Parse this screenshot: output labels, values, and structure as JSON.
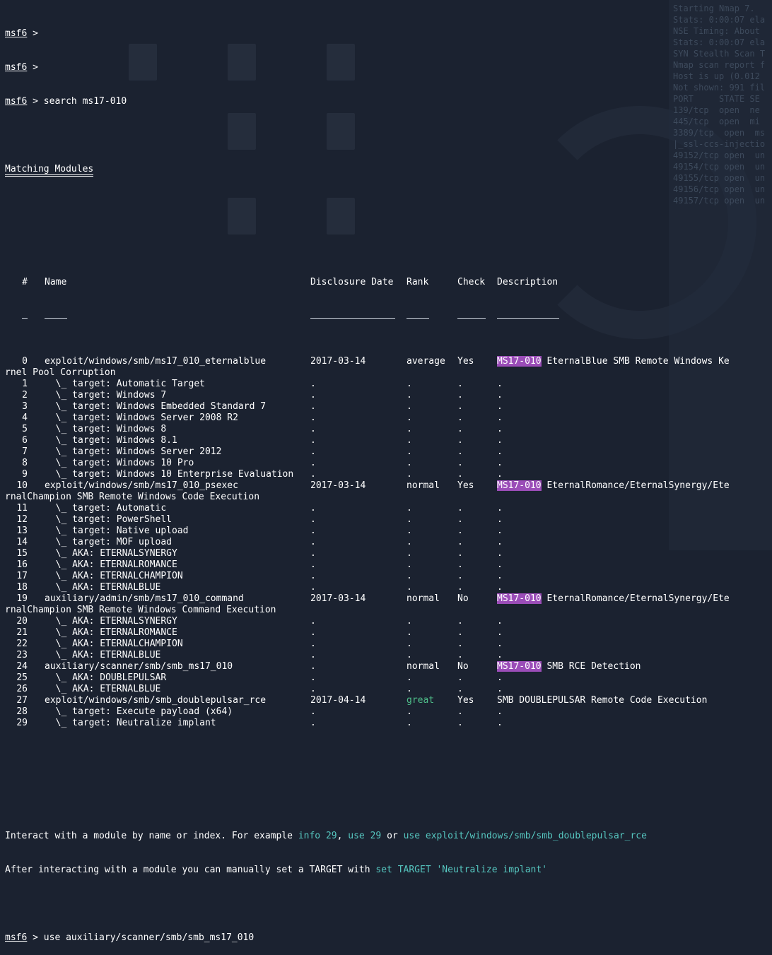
{
  "background": {
    "panel_lines": [
      "Starting Nmap 7.",
      "Stats: 0:00:07 ela",
      "NSE Timing: About",
      "Stats: 0:00:07 ela",
      "SYN Stealth Scan T",
      "Nmap scan report f",
      "Host is up (0.012",
      "Not shown: 991 fil",
      "PORT     STATE SE",
      "139/tcp  open  ne",
      "445/tcp  open  mi",
      "3389/tcp  open  ms",
      "|_ssl-ccs-injectio",
      "49152/tcp open  un",
      "49154/tcp open  un",
      "49155/tcp open  un",
      "49156/tcp open  un",
      "49157/tcp open  un"
    ]
  },
  "prompt": "msf6",
  "lines_top": [
    {
      "cmd": ""
    },
    {
      "cmd": ""
    },
    {
      "cmd": " search ms17-010"
    }
  ],
  "heading": "Matching Modules",
  "table": {
    "headers": {
      "num": "#",
      "name": "Name",
      "date": "Disclosure Date",
      "rank": "Rank",
      "check": "Check",
      "desc": "Description"
    },
    "rows": [
      {
        "num": "0",
        "name": "exploit/windows/smb/ms17_010_eternalblue",
        "date": "2017-03-14",
        "rank": "average",
        "check": "Yes",
        "tag": "MS17-010",
        "desc": " EternalBlue SMB Remote Windows Ke",
        "wrap": "rnel Pool Corruption"
      },
      {
        "num": "1",
        "name": "  \\_ target: Automatic Target",
        "date": ".",
        "rank": ".",
        "check": ".",
        "desc": "."
      },
      {
        "num": "2",
        "name": "  \\_ target: Windows 7",
        "date": ".",
        "rank": ".",
        "check": ".",
        "desc": "."
      },
      {
        "num": "3",
        "name": "  \\_ target: Windows Embedded Standard 7",
        "date": ".",
        "rank": ".",
        "check": ".",
        "desc": "."
      },
      {
        "num": "4",
        "name": "  \\_ target: Windows Server 2008 R2",
        "date": ".",
        "rank": ".",
        "check": ".",
        "desc": "."
      },
      {
        "num": "5",
        "name": "  \\_ target: Windows 8",
        "date": ".",
        "rank": ".",
        "check": ".",
        "desc": "."
      },
      {
        "num": "6",
        "name": "  \\_ target: Windows 8.1",
        "date": ".",
        "rank": ".",
        "check": ".",
        "desc": "."
      },
      {
        "num": "7",
        "name": "  \\_ target: Windows Server 2012",
        "date": ".",
        "rank": ".",
        "check": ".",
        "desc": "."
      },
      {
        "num": "8",
        "name": "  \\_ target: Windows 10 Pro",
        "date": ".",
        "rank": ".",
        "check": ".",
        "desc": "."
      },
      {
        "num": "9",
        "name": "  \\_ target: Windows 10 Enterprise Evaluation",
        "date": ".",
        "rank": ".",
        "check": ".",
        "desc": "."
      },
      {
        "num": "10",
        "name": "exploit/windows/smb/ms17_010_psexec",
        "date": "2017-03-14",
        "rank": "normal",
        "check": "Yes",
        "tag": "MS17-010",
        "desc": " EternalRomance/EternalSynergy/Ete",
        "wrap": "rnalChampion SMB Remote Windows Code Execution"
      },
      {
        "num": "11",
        "name": "  \\_ target: Automatic",
        "date": ".",
        "rank": ".",
        "check": ".",
        "desc": "."
      },
      {
        "num": "12",
        "name": "  \\_ target: PowerShell",
        "date": ".",
        "rank": ".",
        "check": ".",
        "desc": "."
      },
      {
        "num": "13",
        "name": "  \\_ target: Native upload",
        "date": ".",
        "rank": ".",
        "check": ".",
        "desc": "."
      },
      {
        "num": "14",
        "name": "  \\_ target: MOF upload",
        "date": ".",
        "rank": ".",
        "check": ".",
        "desc": "."
      },
      {
        "num": "15",
        "name": "  \\_ AKA: ETERNALSYNERGY",
        "date": ".",
        "rank": ".",
        "check": ".",
        "desc": "."
      },
      {
        "num": "16",
        "name": "  \\_ AKA: ETERNALROMANCE",
        "date": ".",
        "rank": ".",
        "check": ".",
        "desc": "."
      },
      {
        "num": "17",
        "name": "  \\_ AKA: ETERNALCHAMPION",
        "date": ".",
        "rank": ".",
        "check": ".",
        "desc": "."
      },
      {
        "num": "18",
        "name": "  \\_ AKA: ETERNALBLUE",
        "date": ".",
        "rank": ".",
        "check": ".",
        "desc": "."
      },
      {
        "num": "19",
        "name": "auxiliary/admin/smb/ms17_010_command",
        "date": "2017-03-14",
        "rank": "normal",
        "check": "No",
        "tag": "MS17-010",
        "desc": " EternalRomance/EternalSynergy/Ete",
        "wrap": "rnalChampion SMB Remote Windows Command Execution"
      },
      {
        "num": "20",
        "name": "  \\_ AKA: ETERNALSYNERGY",
        "date": ".",
        "rank": ".",
        "check": ".",
        "desc": "."
      },
      {
        "num": "21",
        "name": "  \\_ AKA: ETERNALROMANCE",
        "date": ".",
        "rank": ".",
        "check": ".",
        "desc": "."
      },
      {
        "num": "22",
        "name": "  \\_ AKA: ETERNALCHAMPION",
        "date": ".",
        "rank": ".",
        "check": ".",
        "desc": "."
      },
      {
        "num": "23",
        "name": "  \\_ AKA: ETERNALBLUE",
        "date": ".",
        "rank": ".",
        "check": ".",
        "desc": "."
      },
      {
        "num": "24",
        "name": "auxiliary/scanner/smb/smb_ms17_010",
        "date": ".",
        "rank": "normal",
        "check": "No",
        "tag": "MS17-010",
        "desc": " SMB RCE Detection"
      },
      {
        "num": "25",
        "name": "  \\_ AKA: DOUBLEPULSAR",
        "date": ".",
        "rank": ".",
        "check": ".",
        "desc": "."
      },
      {
        "num": "26",
        "name": "  \\_ AKA: ETERNALBLUE",
        "date": ".",
        "rank": ".",
        "check": ".",
        "desc": "."
      },
      {
        "num": "27",
        "name": "exploit/windows/smb/smb_doublepulsar_rce",
        "date": "2017-04-14",
        "rank": "great",
        "rank_color": "#4fbf8a",
        "check": "Yes",
        "desc": "SMB DOUBLEPULSAR Remote Code Execution"
      },
      {
        "num": "28",
        "name": "  \\_ target: Execute payload (x64)",
        "date": ".",
        "rank": ".",
        "check": ".",
        "desc": "."
      },
      {
        "num": "29",
        "name": "  \\_ target: Neutralize implant",
        "date": ".",
        "rank": ".",
        "check": ".",
        "desc": "."
      }
    ]
  },
  "footer": {
    "line1_a": "Interact with a module by name or index. For example ",
    "line1_cmd1": "info 29",
    "line1_b": ", ",
    "line1_cmd2": "use 29",
    "line1_c": " or ",
    "line1_cmd3": "use exploit/windows/smb/smb_doublepulsar_rce",
    "line2_a": "After interacting with a module you can manually set a TARGET with ",
    "line2_cmd": "set TARGET 'Neutralize implant'"
  },
  "last_cmd": " use auxiliary/scanner/smb/smb_ms17_010",
  "colors": {
    "background": "#1b2230",
    "highlight": "#9b4db8",
    "cyan": "#56c7c0",
    "green": "#4fbf8a"
  }
}
